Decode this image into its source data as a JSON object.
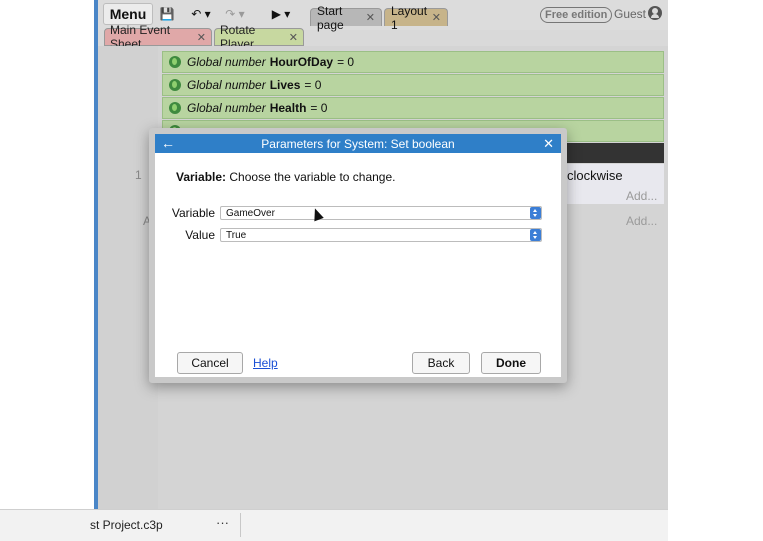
{
  "toolbar": {
    "menu_label": "Menu",
    "save_icon": "save-icon",
    "undo_icon": "undo-icon",
    "redo_icon": "redo-icon",
    "play_icon": "play-icon",
    "save_glyph": "💾",
    "undo_glyph": "↶ ▾",
    "redo_glyph": "↷ ▾",
    "play_glyph": "▶ ▾",
    "tabs": [
      {
        "label": "Start page",
        "close": "✕"
      },
      {
        "label": "Layout 1",
        "close": "✕"
      }
    ],
    "edition_label": "Free edition",
    "user_label": "Guest"
  },
  "sheet_tabs": [
    {
      "label": "Main Event Sheet",
      "close": "✕"
    },
    {
      "label": "Rotate Player",
      "close": "✕"
    }
  ],
  "event_sheet": {
    "globals": [
      {
        "prefix": "Global number",
        "name": "HourOfDay",
        "value": "= 0"
      },
      {
        "prefix": "Global number",
        "name": "Lives",
        "value": "= 0"
      },
      {
        "prefix": "Global number",
        "name": "Health",
        "value": "= 0"
      }
    ],
    "row_number": "1",
    "row_letter": "A",
    "action_text": "clockwise",
    "add_label": "Add..."
  },
  "dialog": {
    "title": "Parameters for System: Set boolean",
    "back_glyph": "←",
    "close_glyph": "✕",
    "description_label": "Variable:",
    "description_text": "Choose the variable to change.",
    "fields": [
      {
        "label": "Variable",
        "value": "GameOver"
      },
      {
        "label": "Value",
        "value": "True"
      }
    ],
    "cancel_label": "Cancel",
    "help_label": "Help",
    "back_label": "Back",
    "done_label": "Done"
  },
  "bottom_bar": {
    "project_label": "st Project.c3p",
    "more_label": "···"
  },
  "colors": {
    "accent": "#2f7fc8",
    "global_row": "#b8d4a0",
    "main_sheet_tab": "#e0a8a8",
    "rotate_sheet_tab": "#c7d8a0",
    "layout_tab": "#c7b48a"
  }
}
